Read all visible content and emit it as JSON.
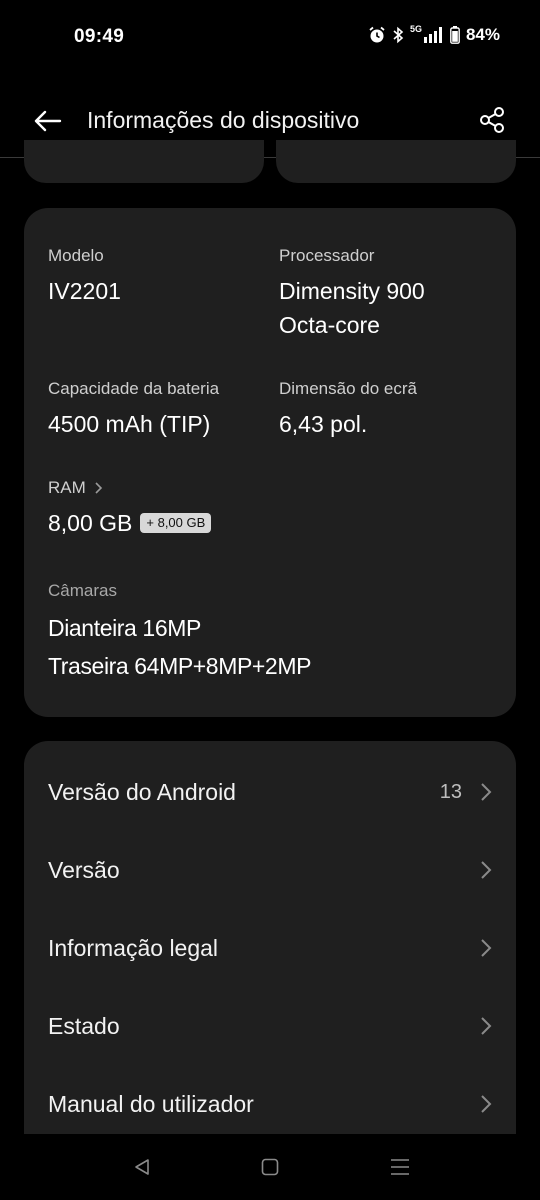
{
  "status_bar": {
    "time": "09:49",
    "network_label": "5G",
    "battery": "84%",
    "icons": [
      "alarm-icon",
      "bluetooth-icon",
      "signal-icon",
      "battery-icon"
    ]
  },
  "app_bar": {
    "title": "Informações do dispositivo",
    "back_icon": "arrow-left-icon",
    "share_icon": "share-icon"
  },
  "specs": {
    "model": {
      "label": "Modelo",
      "value": "IV2201"
    },
    "processor": {
      "label": "Processador",
      "value_line1": "Dimensity 900",
      "value_line2": "Octa-core"
    },
    "battery": {
      "label": "Capacidade da bateria",
      "value": "4500 mAh (TIP)"
    },
    "screen": {
      "label": "Dimensão do ecrã",
      "value": "6,43 pol."
    },
    "ram": {
      "label": "RAM",
      "value": "8,00 GB",
      "extended": "+ 8,00 GB"
    },
    "cameras": {
      "label": "Câmaras",
      "front": "Dianteira 16MP",
      "rear": "Traseira 64MP+8MP+2MP"
    }
  },
  "menu": {
    "items": [
      {
        "label": "Versão do Android",
        "value": "13"
      },
      {
        "label": "Versão"
      },
      {
        "label": "Informação legal"
      },
      {
        "label": "Estado"
      },
      {
        "label": "Manual do utilizador"
      }
    ]
  },
  "nav_bar": {
    "icons": [
      "back-triangle-icon",
      "home-square-icon",
      "recents-menu-icon"
    ]
  },
  "colors": {
    "background": "#000000",
    "card": "#1f1f1f",
    "text_primary": "#ffffff",
    "text_secondary": "#cfcfcf"
  }
}
